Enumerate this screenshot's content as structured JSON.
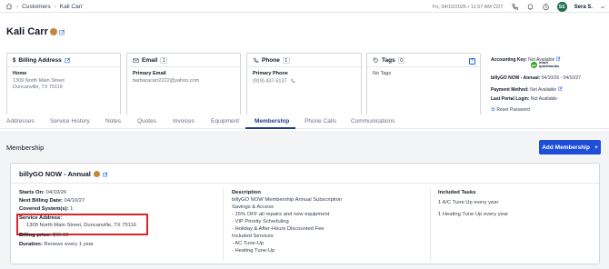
{
  "breadcrumb": {
    "root": "Customers",
    "current": "Kali Carr"
  },
  "topbar": {
    "datetime": "Fri, 04/10/2026 • 11:57 AM CDT",
    "user_initials": "SS",
    "user_name": "Sera S."
  },
  "customer": {
    "name": "Kali Carr"
  },
  "billing": {
    "title": "Billing Address",
    "label": "Home",
    "line1": "1309 North Main Street",
    "line2": "Duncanville, TX 75116"
  },
  "email": {
    "title": "Email",
    "count": "1",
    "label": "Primary Email",
    "value": "barbaracarr2222@yahoo.com"
  },
  "phone": {
    "title": "Phone",
    "count": "1",
    "label": "Primary Phone",
    "value": "(919) 437-5137"
  },
  "tags": {
    "title": "Tags",
    "count": "0",
    "value": "No Tags",
    "add": "+"
  },
  "account": {
    "key_label": "Accounting Key:",
    "key_value": "Not Available",
    "qb_line1": "intuit",
    "qb_line2": "quickbooks",
    "billygo_label": "billyGO NOW - Annual:",
    "billygo_value": "04/10/26 - 04/10/27",
    "payment_label": "Payment Method:",
    "payment_value": "Not Available",
    "portal_label": "Last Portal Login:",
    "portal_value": "Not Available",
    "reset_label": "Reset Password"
  },
  "tabs": [
    "Addresses",
    "Service History",
    "Notes",
    "Quotes",
    "Invoices",
    "Equipment",
    "Membership",
    "Phone Calls",
    "Communications"
  ],
  "membership": {
    "section_title": "Membership",
    "add_button": "Add Membership",
    "add_icon": "+",
    "plan_title": "billyGO NOW - Annual",
    "starts_label": "Starts On:",
    "starts_value": "04/10/26",
    "next_label": "Next Billing Date:",
    "next_value": "04/10/27",
    "covered_label": "Covered System(s):",
    "covered_value": "1",
    "service_label": "Service Address:",
    "service_value": "1309 North Main Street, Duncanville, TX 75116",
    "price_label": "Billing price:",
    "price_value": "$99.00",
    "duration_label": "Duration:",
    "duration_value": "Renews every 1 year",
    "description_title": "Description",
    "description_lines": [
      "billyGO NOW Membership Annual Subscription",
      "Savings & Access",
      "- 15% OFF all repairs and new equipment",
      "- VIP Priority Scheduling",
      "- Holiday & After-Hours Discounted Fee",
      "Included Services",
      "- AC Tune-Up",
      "- Heating Tune-Up"
    ],
    "tasks_title": "Included Tasks",
    "tasks": [
      "1 A/C Tune Up every year",
      "1 Heating Tune Up every year"
    ]
  },
  "colors": {
    "accent": "#1d4ed8",
    "tab_active": "#1e3a8a",
    "highlight": "#dc2626",
    "avatar": "#1f6f50"
  }
}
